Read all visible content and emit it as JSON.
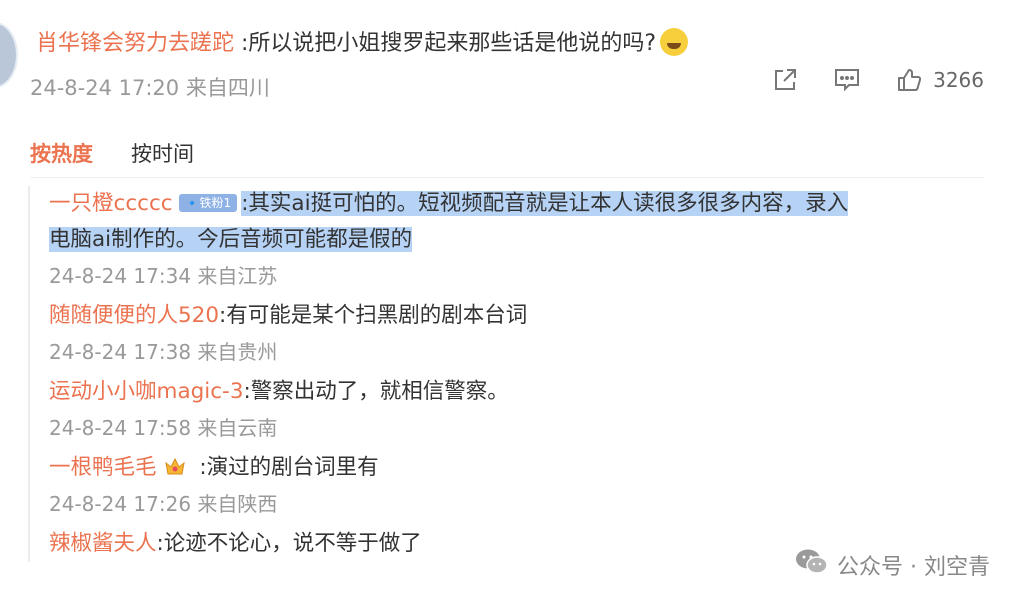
{
  "main_comment": {
    "username": "肖华锋会努力去蹉跎",
    "text": " :所以说把小姐搜罗起来那些话是他说的吗?",
    "emoji": "laughing-face-icon",
    "meta": "24-8-24 17:20 来自四川",
    "like_count": "3266"
  },
  "sort_tabs": {
    "hot": "按热度",
    "time": "按时间"
  },
  "replies": [
    {
      "username": "一只橙ccccc",
      "badge": "🔹铁粉1",
      "text": ":其实ai挺可怕的。短视频配音就是让本人读很多很多内容，录入",
      "text2": "电脑ai制作的。今后音频可能都是假的",
      "meta": "24-8-24 17:34 来自江苏"
    },
    {
      "username": "随随便便的人520",
      "text": ":有可能是某个扫黑剧的剧本台词",
      "meta": "24-8-24 17:38 来自贵州"
    },
    {
      "username": "运动小小咖magic-3",
      "text": ":警察出动了，就相信警察。",
      "meta": "24-8-24 17:58 来自云南"
    },
    {
      "username": "一根鸭毛毛",
      "text": " :演过的剧台词里有",
      "meta": "24-8-24 17:26 来自陕西"
    },
    {
      "username": "辣椒酱夫人",
      "text": ":论迹不论心，说不等于做了"
    }
  ],
  "watermark": {
    "text": "公众号 · 刘空青"
  },
  "colors": {
    "accent": "#eb7350",
    "highlight": "#b6d3f5",
    "meta": "#999999"
  }
}
